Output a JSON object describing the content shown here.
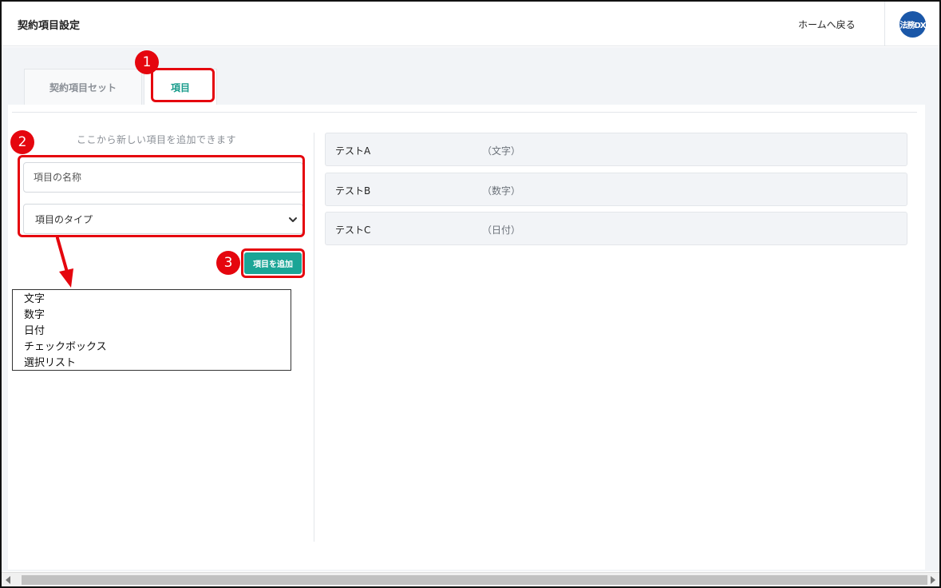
{
  "header": {
    "title": "契約項目設定",
    "home_link": "ホームへ戻る",
    "logo_text": "法務DX"
  },
  "tabs": [
    {
      "label": "契約項目セット",
      "active": false
    },
    {
      "label": "項目",
      "active": true
    }
  ],
  "form": {
    "hint": "ここから新しい項目を追加できます",
    "name_placeholder": "項目の名称",
    "type_selected": "項目のタイプ",
    "add_button": "項目を追加"
  },
  "type_options": [
    "文字",
    "数字",
    "日付",
    "チェックボックス",
    "選択リスト"
  ],
  "items": [
    {
      "name": "テストA",
      "type": "（文字）"
    },
    {
      "name": "テストB",
      "type": "（数字）"
    },
    {
      "name": "テストC",
      "type": "（日付）"
    }
  ],
  "annotations": [
    "1",
    "2",
    "3"
  ],
  "colors": {
    "accent": "#1aa596",
    "annotation": "#e5060e",
    "logo": "#1a57a8"
  }
}
